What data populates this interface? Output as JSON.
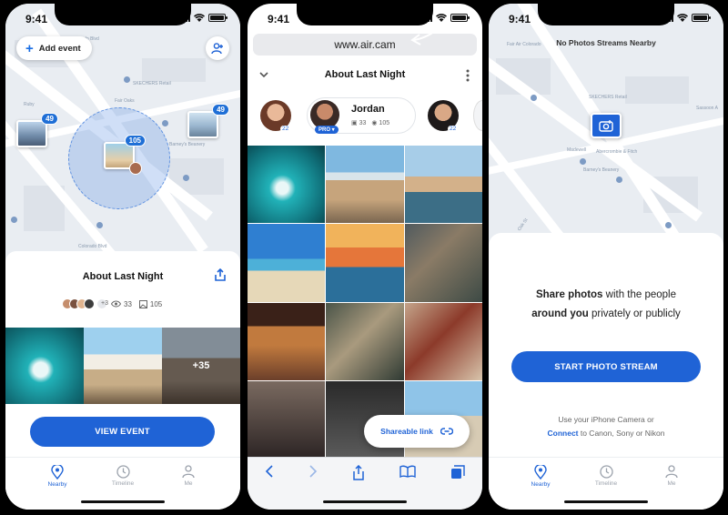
{
  "status": {
    "time": "9:41"
  },
  "screen1": {
    "add_event": "Add event",
    "clusters": {
      "left": "49",
      "center": "105",
      "right": "49"
    },
    "streets": [
      "East Colorado Blvd",
      "Fair Oaks",
      "SKECHERS Retail",
      "Ruby",
      "Barney's Beanery",
      "Colorado Blvd"
    ],
    "event_title": "About Last Night",
    "attendees_more": "+3",
    "views": "33",
    "photos": "105",
    "more_photos": "+35",
    "view_event": "VIEW EVENT"
  },
  "screen2": {
    "url": "www.air.cam",
    "album_title": "About Last Night",
    "people_count_left": "22",
    "people_count_right": "22",
    "person_name": "Jordan",
    "person_photos": "33",
    "person_views": "105",
    "pro_label": "PRO",
    "shareable_link": "Shareable link"
  },
  "screen3": {
    "no_streams": "No Photos Streams Nearby",
    "streets": [
      "Fair Air Colorado",
      "SKECHERS Retail",
      "Madewell",
      "Abercrombie & Fitch",
      "Barney's Beanery",
      "Sassoon A",
      "Oak St"
    ],
    "pitch_bold_1": "Share photos",
    "pitch_1": " with the people",
    "pitch_bold_2": "around you",
    "pitch_2": " privately or publicly",
    "start_stream": "START PHOTO STREAM",
    "help_1": "Use your iPhone Camera or",
    "help_link": "Connect",
    "help_2": " to Canon, Sony or Nikon"
  },
  "tabs": [
    {
      "label": "Nearby",
      "icon": "pin-icon"
    },
    {
      "label": "Timeline",
      "icon": "clock-icon"
    },
    {
      "label": "Me",
      "icon": "person-icon"
    }
  ],
  "colors": {
    "accent": "#1f63d6",
    "map": "#e9edf2",
    "radius": "#5b8fe0"
  }
}
